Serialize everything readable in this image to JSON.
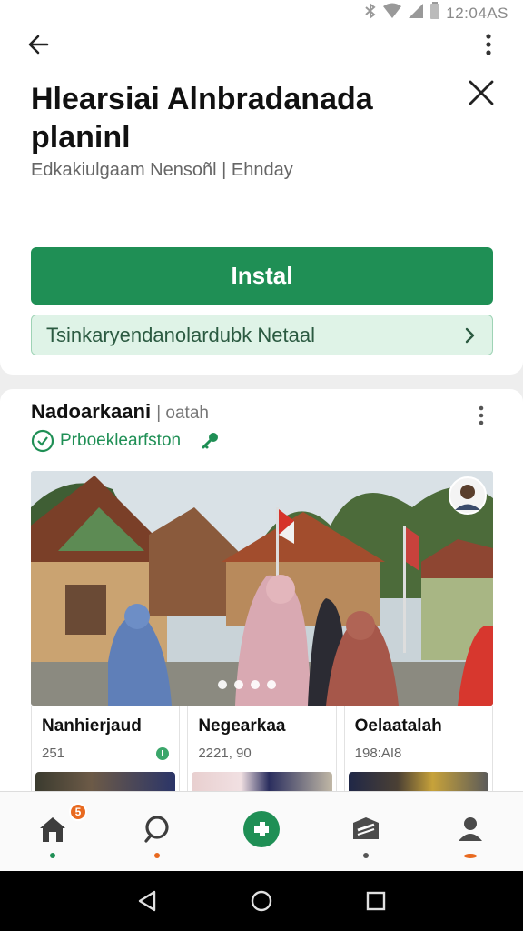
{
  "status_bar": {
    "time": "12:04AS"
  },
  "header": {
    "title": "Hlearsiai Alnbradanada planinl",
    "subtitle": "Edkakiulgaam Nensoñl | Ehnday"
  },
  "actions": {
    "install_label": "Instal",
    "secondary_label": "Tsinkaryendanolardubk Netaal"
  },
  "post": {
    "author": "Nadoarkaani",
    "author_extra": "| oatah",
    "tag": "Prboeklearfston",
    "carousel_dots": 4,
    "tiles": [
      {
        "title": "Nanhierjaud",
        "meta": "251"
      },
      {
        "title": "Negearkaa",
        "meta": "2221, 90"
      },
      {
        "title": "Oelaatalah",
        "meta": "198:AI8"
      }
    ]
  },
  "bottom_nav": {
    "items": [
      "home-icon",
      "search-icon",
      "add-icon",
      "inbox-icon",
      "profile-icon"
    ],
    "home_badge": "5",
    "accent": "#1f8f55",
    "badge_color": "#e8691f"
  },
  "system_nav": [
    "back-triangle-icon",
    "home-circle-icon",
    "recents-square-icon"
  ]
}
